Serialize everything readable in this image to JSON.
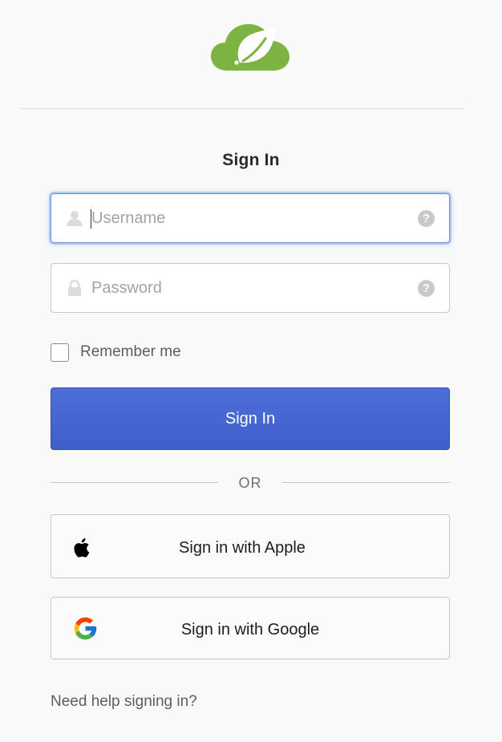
{
  "brand": {
    "logo_icon": "spring-leaf-cloud-logo",
    "color": "#7db343"
  },
  "form": {
    "heading": "Sign In",
    "username": {
      "placeholder": "Username",
      "value": "",
      "icon": "user-icon",
      "help_icon": "help-icon"
    },
    "password": {
      "placeholder": "Password",
      "value": "",
      "icon": "lock-icon",
      "help_icon": "help-icon"
    },
    "help_glyph": "?",
    "remember_label": "Remember me",
    "remember_checked": false,
    "submit_label": "Sign In",
    "primary_color": "#4564d0"
  },
  "separator_text": "OR",
  "social": {
    "apple_label": "Sign in with Apple",
    "google_label": "Sign in with Google"
  },
  "help_link": "Need help signing in?"
}
